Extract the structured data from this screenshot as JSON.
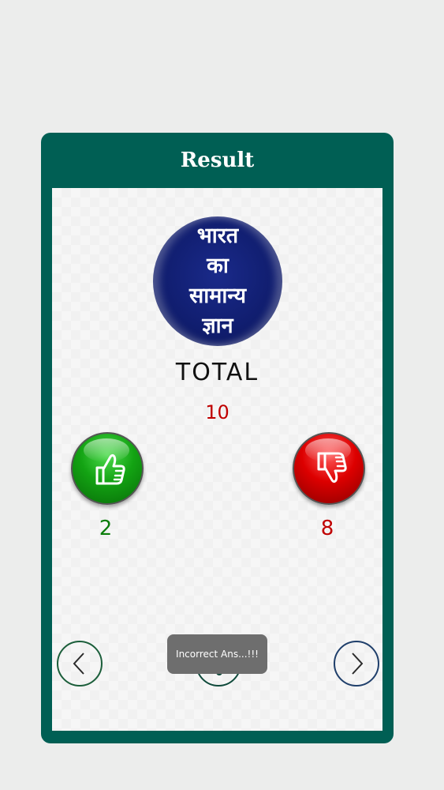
{
  "card": {
    "title": "Result"
  },
  "logo": {
    "lines": [
      "भारत",
      "का",
      "सामान्य",
      "ज्ञान"
    ]
  },
  "total": {
    "label": "TOTAL",
    "value": "10"
  },
  "correct": {
    "count": "2",
    "icon": "thumbs-up-icon",
    "color": "#13a313"
  },
  "incorrect": {
    "count": "8",
    "icon": "thumbs-down-icon",
    "color": "#dd0000"
  },
  "nav": {
    "prev_icon": "chevron-left-icon",
    "next_icon": "chevron-right-icon",
    "center_icon": "share-icon"
  },
  "toast": {
    "text": "Incorrect Ans...!!!"
  },
  "colors": {
    "header": "#005f54",
    "panel": "#f6f6f6"
  }
}
